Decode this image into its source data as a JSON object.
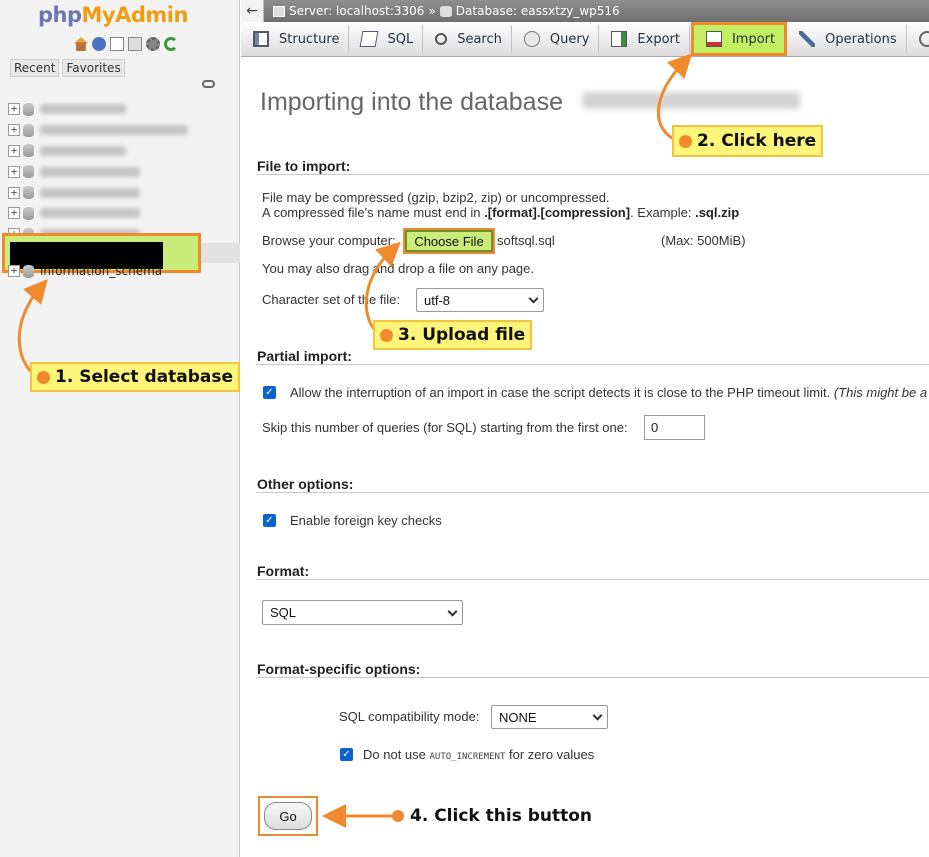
{
  "nav": {
    "logo_php": "php",
    "logo_myadmin": "MyAdmin",
    "tabs": {
      "recent": "Recent",
      "favorites": "Favorites"
    },
    "tree_info_schema": "information_schema"
  },
  "topbar": {
    "back": "←",
    "server": "Server: localhost:3306",
    "separator": "»",
    "database": "Database: eassxtzy_wp516"
  },
  "menu": {
    "structure": "Structure",
    "sql": "SQL",
    "search": "Search",
    "query": "Query",
    "export": "Export",
    "import": "Import",
    "operations": "Operations"
  },
  "page": {
    "title": "Importing into the database",
    "file_section": "File to import:",
    "compress_line1": "File may be compressed (gzip, bzip2, zip) or uncompressed.",
    "compress_line2_a": "A compressed file's name must end in ",
    "compress_line2_b": ".[format].[compression]",
    "compress_line2_c": ". Example: ",
    "compress_line2_d": ".sql.zip",
    "browse_label": "Browse your computer:",
    "choose_file": "Choose File",
    "chosen_file": "softsql.sql",
    "max_size": "(Max: 500MiB)",
    "drag_drop": "You may also drag and drop a file on any page.",
    "charset_label": "Character set of the file:",
    "charset_value": "utf-8",
    "partial_section": "Partial import:",
    "allow_interrupt": "Allow the interruption of an import in case the script detects it is close to the PHP timeout limit.",
    "allow_interrupt_note": "(This might be a",
    "skip_label": "Skip this number of queries (for SQL) starting from the first one:",
    "skip_value": "0",
    "other_section": "Other options:",
    "foreign_keys": "Enable foreign key checks",
    "format_section": "Format:",
    "format_value": "SQL",
    "format_specific_section": "Format-specific options:",
    "compat_label": "SQL compatibility mode:",
    "compat_value": "NONE",
    "auto_inc_a": "Do not use ",
    "auto_inc_code": "AUTO_INCREMENT",
    "auto_inc_b": " for zero values",
    "go": "Go"
  },
  "annotations": {
    "step1": "1. Select database",
    "step2": "2. Click here",
    "step3": "3. Upload file",
    "step4": "4. Click this button"
  },
  "colors": {
    "highlight_green": "#c9ec7a",
    "highlight_border": "#f08a2c",
    "callout_yellow": "#fcf57a",
    "checkbox_blue": "#0b63cf"
  }
}
